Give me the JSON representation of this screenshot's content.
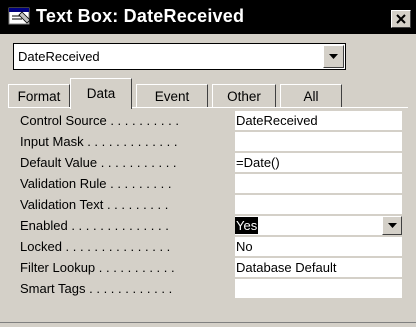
{
  "window": {
    "title": "Text Box: DateReceived"
  },
  "selector": {
    "value": "DateReceived"
  },
  "tabs": [
    {
      "label": "Format",
      "active": false
    },
    {
      "label": "Data",
      "active": true
    },
    {
      "label": "Event",
      "active": false
    },
    {
      "label": "Other",
      "active": false
    },
    {
      "label": "All",
      "active": false
    }
  ],
  "properties": [
    {
      "label": "Control Source . . . . . . . . . .",
      "value": "DateReceived"
    },
    {
      "label": "Input Mask . . . . . . . . . . . . .",
      "value": ""
    },
    {
      "label": "Default Value . . . . . . . . . . .",
      "value": "=Date()"
    },
    {
      "label": "Validation Rule . . . . . . . . .",
      "value": ""
    },
    {
      "label": "Validation Text . . . . . . . . .",
      "value": ""
    },
    {
      "label": "Enabled . . . . . . . . . . . . . .",
      "value": "Yes",
      "selected": true,
      "has_dropdown": true
    },
    {
      "label": "Locked . . . . . . . . . . . . . . .",
      "value": "No"
    },
    {
      "label": "Filter Lookup . . . . . . . . . . .",
      "value": "Database Default"
    },
    {
      "label": "Smart Tags . . . . . . . . . . . .",
      "value": ""
    }
  ],
  "icons": {
    "app": "textbox-properties-icon",
    "close": "close-icon",
    "dropdown": "chevron-down-icon"
  }
}
